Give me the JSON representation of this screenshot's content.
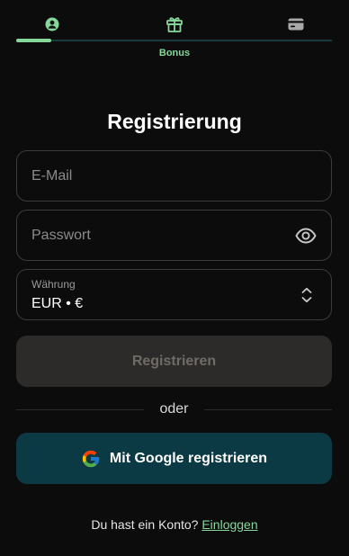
{
  "colors": {
    "background": "#0c0c0c",
    "accent_green": "#86d79a",
    "field_border": "#3c3c3c",
    "register_disabled_bg": "#2d2b29",
    "register_disabled_text": "#6f6b67",
    "google_button_bg": "#0b3a44"
  },
  "stepper": {
    "steps": [
      {
        "icon": "user-icon",
        "active": true
      },
      {
        "icon": "gift-icon",
        "active": false,
        "label": "Bonus"
      },
      {
        "icon": "card-icon",
        "active": false
      }
    ],
    "progress_fraction": 0.11
  },
  "form": {
    "title": "Registrierung",
    "email": {
      "placeholder": "E-Mail",
      "value": ""
    },
    "password": {
      "placeholder": "Passwort",
      "value": "",
      "toggle_icon": "eye-icon"
    },
    "currency": {
      "label": "Währung",
      "value": "EUR • €",
      "icon": "chevron-up-down-icon"
    },
    "submit_label": "Registrieren",
    "divider_text": "oder",
    "google_label": "Mit Google registrieren",
    "login_prompt": "Du hast ein Konto?",
    "login_link": "Einloggen"
  }
}
